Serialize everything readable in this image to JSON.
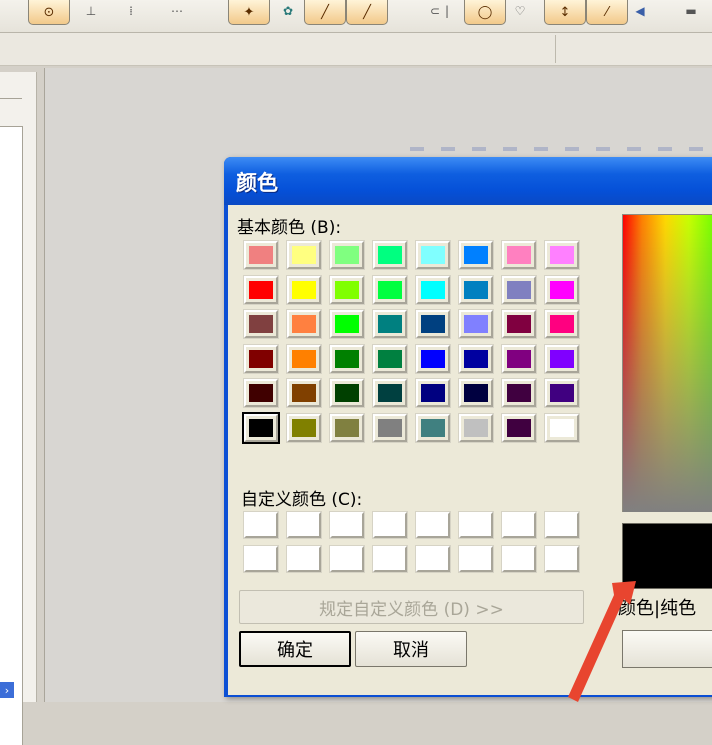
{
  "dialog": {
    "title": "颜色",
    "basic_colors_label": "基本颜色 (B):",
    "custom_colors_label": "自定义颜色 (C):",
    "define_custom_button": "规定自定义颜色 (D) >>",
    "ok_button": "确定",
    "cancel_button": "取消",
    "color_solid_label": "颜色|纯色",
    "basic_colors": [
      [
        "#f08080",
        "#ffff80",
        "#80ff80",
        "#00ff80",
        "#80ffff",
        "#0080ff",
        "#ff80c0",
        "#ff80ff"
      ],
      [
        "#ff0000",
        "#ffff00",
        "#80ff00",
        "#00ff40",
        "#00ffff",
        "#0080c0",
        "#8080c0",
        "#ff00ff"
      ],
      [
        "#804040",
        "#ff8040",
        "#00ff00",
        "#008080",
        "#004080",
        "#8080ff",
        "#800040",
        "#ff0080"
      ],
      [
        "#800000",
        "#ff8000",
        "#008000",
        "#008040",
        "#0000ff",
        "#0000a0",
        "#800080",
        "#8000ff"
      ],
      [
        "#400000",
        "#804000",
        "#004000",
        "#004040",
        "#000080",
        "#000040",
        "#400040",
        "#400080"
      ],
      [
        "#000000",
        "#808000",
        "#808040",
        "#808080",
        "#408080",
        "#c0c0c0",
        "#400040",
        "#ffffff"
      ]
    ],
    "selected_color": "#000000"
  },
  "colors": {
    "title_bar": "#0a58dc",
    "dialog_bg": "#ece9d8",
    "arrow": "#e8452f"
  }
}
